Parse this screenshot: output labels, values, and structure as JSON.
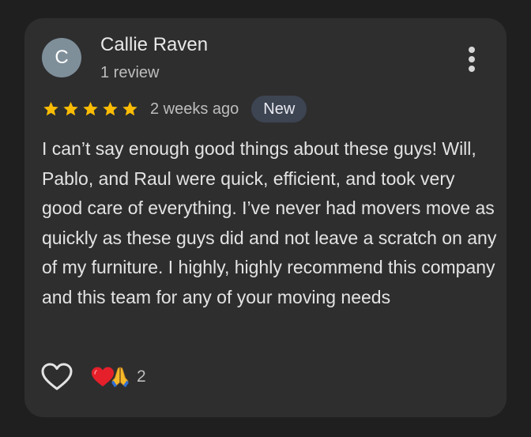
{
  "review": {
    "author": {
      "initial": "C",
      "name": "Callie Raven",
      "review_count": "1 review",
      "avatar_color": "#7f8f9a"
    },
    "rating": 5,
    "star_color": "#fbbc04",
    "date": "2 weeks ago",
    "badge": "New",
    "text": "I can’t say enough good things about these guys! Will, Pablo, and Raul were quick, efficient, and took very good care of everything. I’ve never had movers move as quickly as these guys did and not leave a scratch on any of my furniture. I highly, highly recommend this company and this team for any of your moving needs",
    "reactions": {
      "like_icon": "heart-outline-icon",
      "emojis": [
        "heart-icon",
        "praying-hands-icon"
      ],
      "count": "2"
    }
  }
}
